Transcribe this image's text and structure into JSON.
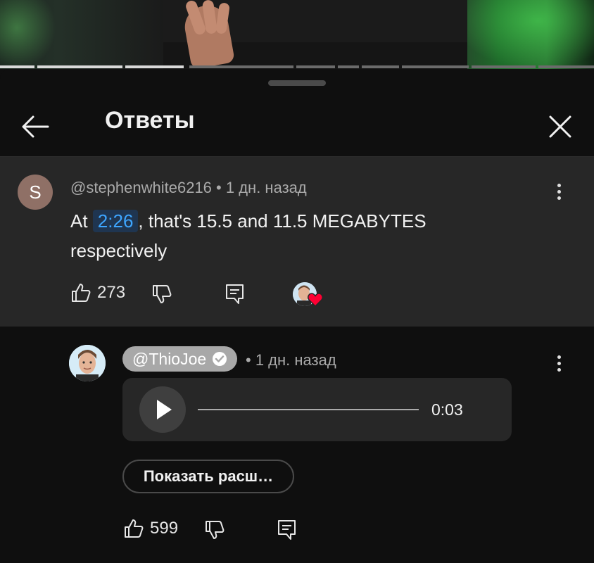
{
  "header": {
    "title": "Ответы"
  },
  "video_progress": {
    "segments": 12,
    "completed_segments": 4
  },
  "parent_comment": {
    "avatar_letter": "S",
    "author": "@stephenwhite6216",
    "separator": "•",
    "time": "1 дн. назад",
    "text_before": "At ",
    "timestamp": "2:26",
    "text_after": ", that's 15.5 and 11.5 MEGABYTES respectively",
    "likes": "273"
  },
  "reply": {
    "author": "@ThioJoe",
    "separator": "•",
    "time": "1 дн. назад",
    "audio_duration": "0:03",
    "show_more": "Показать расш…",
    "likes": "599"
  },
  "icons": {
    "back": "arrow-left-icon",
    "close": "close-icon",
    "more": "more-vert-icon",
    "like": "thumb-up-icon",
    "dislike": "thumb-down-icon",
    "reply": "comment-icon",
    "heart": "heart-icon",
    "verified": "verified-check-icon",
    "play": "play-icon"
  },
  "colors": {
    "background": "#0f0f0f",
    "highlight": "#272727",
    "link": "#3ea6ff",
    "heart": "#ff0033",
    "avatar_s": "#8f7066"
  }
}
